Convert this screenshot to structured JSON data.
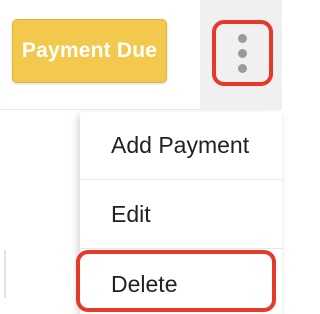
{
  "header": {
    "status_button_label": "Payment Due",
    "more_actions_icon": "more-vertical-icon"
  },
  "menu": {
    "items": [
      {
        "label": "Add Payment"
      },
      {
        "label": "Edit"
      },
      {
        "label": "Delete"
      }
    ]
  },
  "colors": {
    "status_button": "#f2c94c",
    "highlight": "#e53a2a",
    "menu_text": "#222222"
  }
}
